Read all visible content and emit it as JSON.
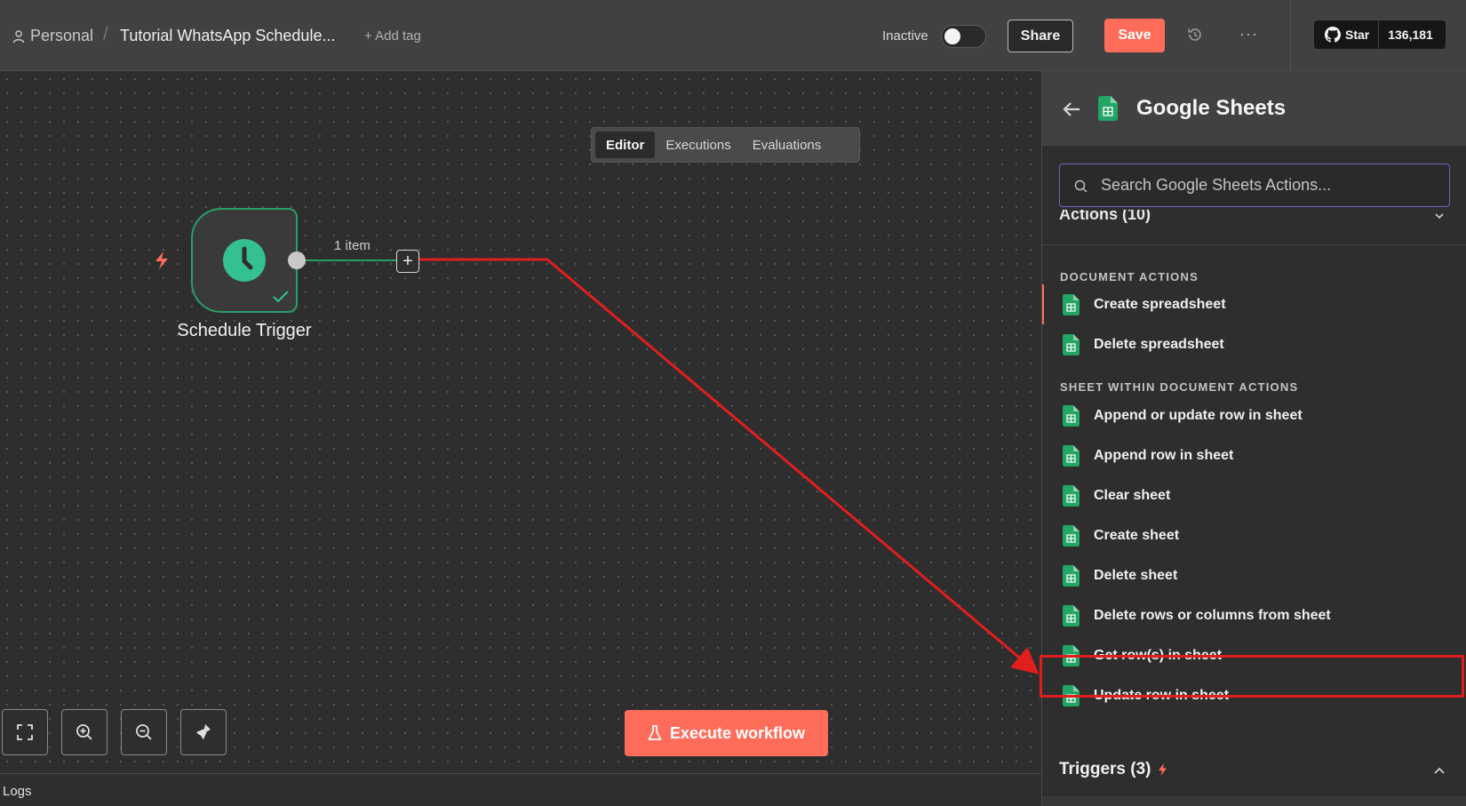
{
  "header": {
    "breadcrumb_personal": "Personal",
    "breadcrumb_sep": "/",
    "workflow_title": "Tutorial WhatsApp Schedule...",
    "add_tag": "+ Add tag",
    "status_label": "Inactive",
    "share_label": "Share",
    "save_label": "Save",
    "more_label": "···",
    "github_star_label": "Star",
    "github_star_count": "136,181"
  },
  "tabs": [
    {
      "label": "Editor",
      "active": true
    },
    {
      "label": "Executions",
      "active": false
    },
    {
      "label": "Evaluations",
      "active": false
    }
  ],
  "canvas": {
    "node_label": "Schedule Trigger",
    "connection_label": "1 item",
    "plus_label": "+",
    "execute_label": "Execute workflow",
    "logs_label": "Logs"
  },
  "panel": {
    "title": "Google Sheets",
    "search_placeholder": "Search Google Sheets Actions...",
    "actions_header": "Actions (10)",
    "section_document": "DOCUMENT ACTIONS",
    "section_sheet": "SHEET WITHIN DOCUMENT ACTIONS",
    "document_actions": [
      "Create spreadsheet",
      "Delete spreadsheet"
    ],
    "sheet_actions": [
      "Append or update row in sheet",
      "Append row in sheet",
      "Clear sheet",
      "Create sheet",
      "Delete sheet",
      "Delete rows or columns from sheet",
      "Get row(s) in sheet",
      "Update row in sheet"
    ],
    "highlighted_item": "Get row(s) in sheet",
    "triggers_header": "Triggers (3)"
  },
  "colors": {
    "accent": "#ff6d5a",
    "node_border": "#2a9d68",
    "annotation": "#e01e1e",
    "search_focus": "#6b63c4",
    "sheets_green": "#23a566"
  }
}
